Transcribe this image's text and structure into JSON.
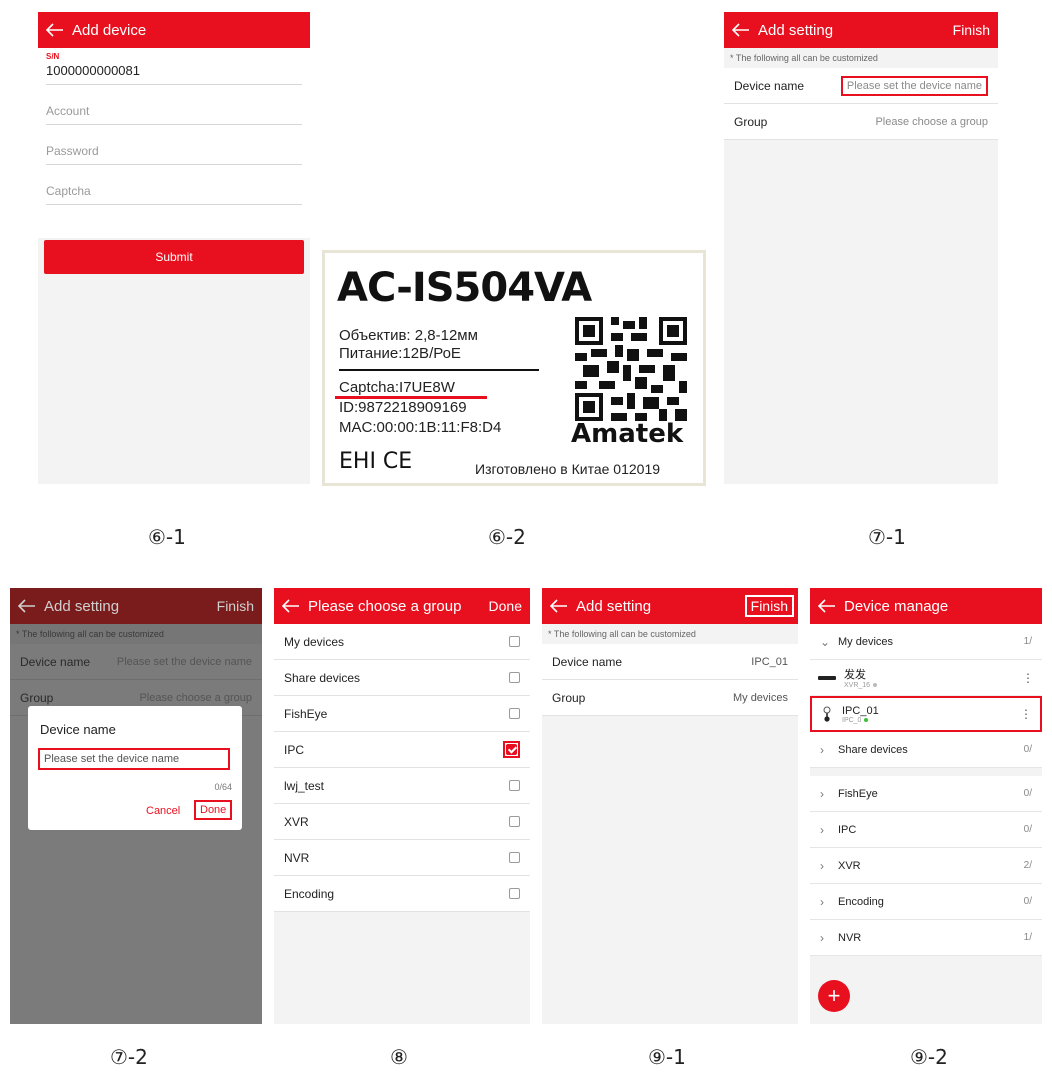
{
  "captions": [
    "⑥-1",
    "⑥-2",
    "⑦-1",
    "⑦-2",
    "⑧",
    "⑨-1",
    "⑨-2"
  ],
  "p61": {
    "title": "Add device",
    "sn_label": "S/N",
    "sn_value": "1000000000081",
    "account_placeholder": "Account",
    "password_placeholder": "Password",
    "captcha_placeholder": "Captcha",
    "submit_label": "Submit"
  },
  "label": {
    "model": "AC-IS504VA",
    "lens": "Объектив: 2,8-12мм",
    "power": "Питание:12В/РоЕ",
    "captcha": "Captcha:I7UE8W",
    "id": "ID:9872218909169",
    "mac": "MAC:00:00:1B:11:F8:D4",
    "brand": "Amatek",
    "marks": "EHI CE",
    "made_in": "Изготовлено в Китае 012019"
  },
  "p71": {
    "title": "Add setting",
    "finish": "Finish",
    "hint": "* The following all can be customized",
    "device_name_label": "Device name",
    "device_name_placeholder": "Please set the device name",
    "group_label": "Group",
    "group_placeholder": "Please choose a group"
  },
  "p72": {
    "title": "Add setting",
    "finish": "Finish",
    "hint": "* The following all can be customized",
    "device_name_label": "Device name",
    "device_name_placeholder": "Please set the device name",
    "group_label": "Group",
    "group_placeholder": "Please choose a group",
    "dialog_title": "Device name",
    "dialog_placeholder": "Please set the device name",
    "counter": "0/64",
    "cancel": "Cancel",
    "done": "Done"
  },
  "p8": {
    "title": "Please choose a group",
    "done": "Done",
    "groups": [
      {
        "label": "My devices",
        "checked": false
      },
      {
        "label": "Share devices",
        "checked": false
      },
      {
        "label": "FishEye",
        "checked": false
      },
      {
        "label": "IPC",
        "checked": true
      },
      {
        "label": "lwj_test",
        "checked": false
      },
      {
        "label": "XVR",
        "checked": false
      },
      {
        "label": "NVR",
        "checked": false
      },
      {
        "label": "Encoding",
        "checked": false
      }
    ]
  },
  "p91": {
    "title": "Add setting",
    "finish": "Finish",
    "hint": "* The following all can be customized",
    "device_name_label": "Device name",
    "device_name_value": "IPC_01",
    "group_label": "Group",
    "group_value": "My devices"
  },
  "p92": {
    "title": "Device manage",
    "my_devices": {
      "label": "My devices",
      "count": "1/"
    },
    "devices": [
      {
        "name": "发发",
        "sub": "XVR_16",
        "dot_color": "#bbbbbb"
      },
      {
        "name": "IPC_01",
        "sub": "IPC_0",
        "dot_color": "#39c139"
      }
    ],
    "groups": [
      {
        "label": "Share devices",
        "count": "0/"
      },
      {
        "label": "FishEye",
        "count": "0/"
      },
      {
        "label": "IPC",
        "count": "0/"
      },
      {
        "label": "XVR",
        "count": "2/"
      },
      {
        "label": "Encoding",
        "count": "0/"
      },
      {
        "label": "NVR",
        "count": "1/"
      }
    ],
    "fab": "+"
  },
  "colors": {
    "accent": "#e8101f",
    "online": "#39c139"
  }
}
